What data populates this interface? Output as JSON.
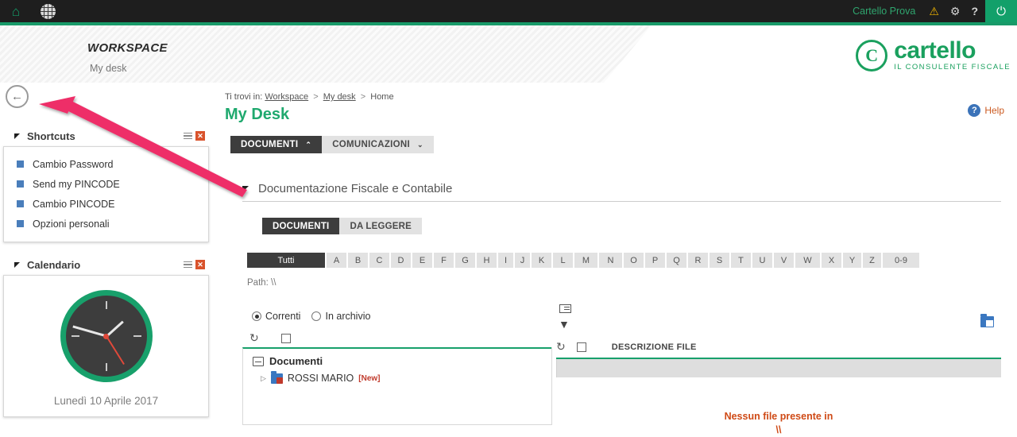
{
  "topbar": {
    "home_icon": "home-icon",
    "globe_icon": "globe-icon",
    "user_name": "Cartello Prova",
    "warning_icon": "⚠",
    "gear_icon": "✿",
    "help_icon": "?",
    "power_icon": "⏻",
    "accent_green": "#189a69",
    "bar_bg": "#1e1e1e"
  },
  "header": {
    "workspace_title": "WORKSPACE",
    "workspace_subtitle": "My desk",
    "logo_word": "cartello",
    "logo_tagline": "IL CONSULENTE FISCALE",
    "logo_mark": "C",
    "logo_color": "#1aa05e"
  },
  "sidebar": {
    "back_icon": "←",
    "shortcuts": {
      "title": "Shortcuts",
      "menu_icon": "menu-icon",
      "close_icon": "✕",
      "items": [
        {
          "label": "Cambio Password"
        },
        {
          "label": "Send my PINCODE"
        },
        {
          "label": "Cambio PINCODE"
        },
        {
          "label": "Opzioni personali"
        }
      ]
    },
    "calendar": {
      "title": "Calendario",
      "menu_icon": "menu-icon",
      "close_icon": "✕",
      "date": "Lunedì 10 Aprile 2017",
      "clock_ring_color": "#18a06b",
      "clock_face_color": "#3d3d3d",
      "second_hand_color": "#e0493a"
    }
  },
  "main": {
    "breadcrumb": {
      "prefix": "Ti trovi in:",
      "items": [
        "Workspace",
        "My desk",
        "Home"
      ],
      "separator": ">"
    },
    "page_title": "My Desk",
    "help": {
      "icon": "?",
      "label": "Help"
    },
    "tabs": [
      {
        "label": "DOCUMENTI",
        "chevron": "⌃",
        "active": true
      },
      {
        "label": "COMUNICAZIONI",
        "chevron": "⌄",
        "active": false
      }
    ],
    "section": {
      "title": "Documentazione Fiscale e Contabile"
    },
    "subtabs": [
      {
        "label": "DOCUMENTI",
        "active": true
      },
      {
        "label": "DA LEGGERE",
        "active": false
      }
    ],
    "alpha_filter": {
      "all_label": "Tutti",
      "letters": [
        "A",
        "B",
        "C",
        "D",
        "E",
        "F",
        "G",
        "H",
        "I",
        "J",
        "K",
        "L",
        "M",
        "N",
        "O",
        "P",
        "Q",
        "R",
        "S",
        "T",
        "U",
        "V",
        "W",
        "X",
        "Y",
        "Z"
      ],
      "digits_label": "0-9"
    },
    "path_label": "Path: \\\\",
    "radios": [
      {
        "label": "Correnti",
        "selected": true
      },
      {
        "label": "In archivio",
        "selected": false
      }
    ],
    "left_tools": {
      "refresh_icon": "↻",
      "checkbox": "checkbox"
    },
    "tree": {
      "root_label": "Documenti",
      "children": [
        {
          "label": "ROSSI MARIO",
          "badge": "[New]",
          "expander": "▷"
        }
      ]
    },
    "file_panel": {
      "list_icon": "list-icon",
      "filter_icon": "▼",
      "folder_icon": "folder-icon",
      "refresh_icon": "↻",
      "column_header": "DESCRIZIONE FILE",
      "empty_line1": "Nessun file presente in",
      "empty_line2": "\\\\",
      "empty_color": "#cf4a16"
    }
  },
  "annotation": {
    "arrow_color": "#ee2f68"
  }
}
